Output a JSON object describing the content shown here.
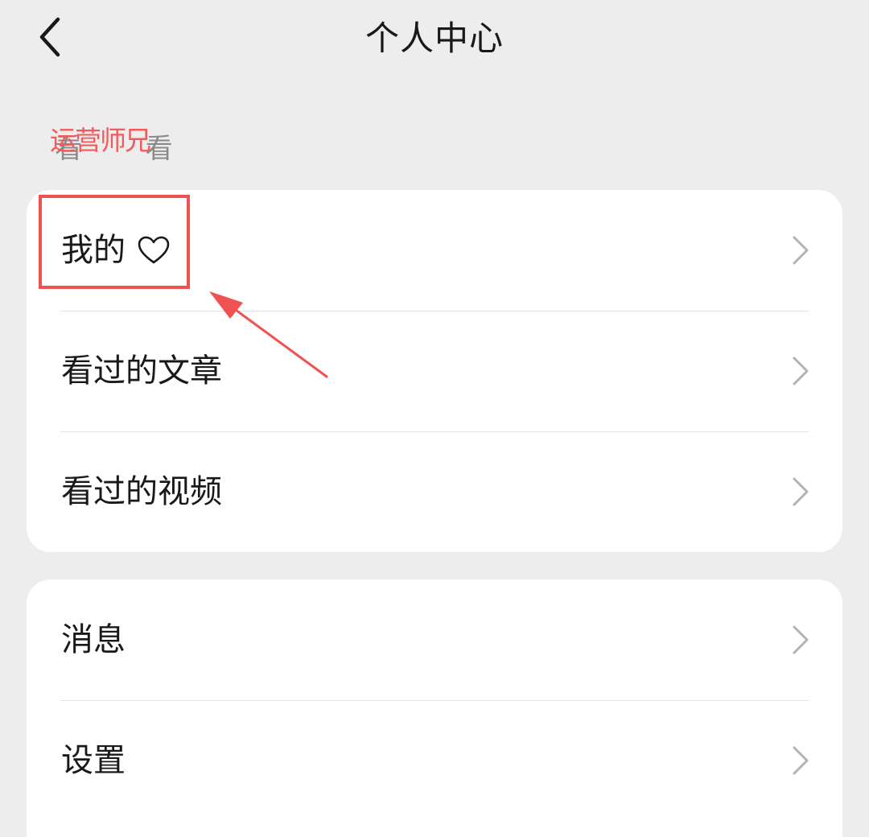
{
  "header": {
    "title": "个人中心"
  },
  "section": {
    "faint_label": "看 看",
    "brand_watermark": "运营师兄"
  },
  "card1": {
    "items": [
      {
        "label": "我的",
        "icon": "heart-icon"
      },
      {
        "label": "看过的文章"
      },
      {
        "label": "看过的视频"
      }
    ]
  },
  "card2": {
    "items": [
      {
        "label": "消息"
      },
      {
        "label": "设置"
      }
    ]
  },
  "colors": {
    "background": "#ededed",
    "card": "#ffffff",
    "text": "#191919",
    "annotation": "#f05252",
    "chevron": "#b2b2b2"
  }
}
